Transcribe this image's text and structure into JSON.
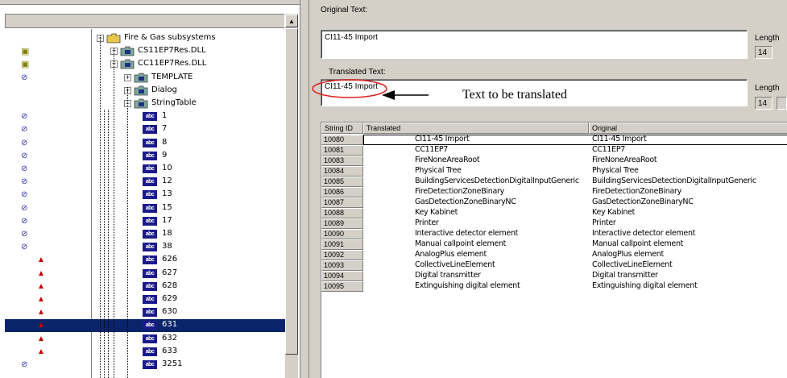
{
  "tree": {
    "scroll_up_glyph": "▲",
    "nodes": [
      {
        "label": "Fire & Gas subsystems",
        "icon": "folder-icon",
        "status": ""
      },
      {
        "label": "CS11EP7Res.DLL",
        "icon": "resource-dll-icon",
        "status": "dll"
      },
      {
        "label": "CC11EP7Res.DLL",
        "icon": "resource-dll-icon",
        "status": "dll"
      },
      {
        "label": "TEMPLATE",
        "icon": "resource-folder-icon",
        "status": "ok"
      },
      {
        "label": "Dialog",
        "icon": "resource-folder-icon",
        "status": ""
      },
      {
        "label": "StringTable",
        "icon": "resource-folder-icon",
        "status": ""
      },
      {
        "label": "1",
        "icon": "string-icon",
        "status": "ok"
      },
      {
        "label": "7",
        "icon": "string-icon",
        "status": "ok"
      },
      {
        "label": "8",
        "icon": "string-icon",
        "status": "ok"
      },
      {
        "label": "9",
        "icon": "string-icon",
        "status": "ok"
      },
      {
        "label": "10",
        "icon": "string-icon",
        "status": "ok"
      },
      {
        "label": "12",
        "icon": "string-icon",
        "status": "ok"
      },
      {
        "label": "13",
        "icon": "string-icon",
        "status": "ok"
      },
      {
        "label": "15",
        "icon": "string-icon",
        "status": "ok"
      },
      {
        "label": "17",
        "icon": "string-icon",
        "status": "ok"
      },
      {
        "label": "18",
        "icon": "string-icon",
        "status": "ok"
      },
      {
        "label": "38",
        "icon": "string-icon",
        "status": "ok"
      },
      {
        "label": "626",
        "icon": "string-icon",
        "status": "warn"
      },
      {
        "label": "627",
        "icon": "string-icon",
        "status": "warn"
      },
      {
        "label": "628",
        "icon": "string-icon",
        "status": "warn"
      },
      {
        "label": "629",
        "icon": "string-icon",
        "status": "warn"
      },
      {
        "label": "630",
        "icon": "string-icon",
        "status": "warn"
      },
      {
        "label": "631",
        "icon": "string-icon",
        "status": "warn",
        "selected": true
      },
      {
        "label": "632",
        "icon": "string-icon",
        "status": "warn"
      },
      {
        "label": "633",
        "icon": "string-icon",
        "status": "warn"
      },
      {
        "label": "3251",
        "icon": "string-icon",
        "status": "ok"
      }
    ],
    "string_icon_text": "abc",
    "expand_glyph": "+",
    "collapse_glyph": "−"
  },
  "editor": {
    "original_label": "Original Text:",
    "original_value": "CI11-45 Import",
    "original_length_label": "Length",
    "original_length": "14",
    "translated_label": "Translated Text:",
    "translated_value": "CI11-45 Import",
    "translated_length_label": "Length",
    "translated_length": "14"
  },
  "annotation": {
    "text": "Text to be translated"
  },
  "grid": {
    "columns": [
      "String ID",
      "Translated",
      "Original"
    ],
    "rows": [
      {
        "id": "10080",
        "translated": "CI11-45 Import",
        "original": "CI11-45 Import"
      },
      {
        "id": "10081",
        "translated": "CC11EP7",
        "original": "CC11EP7"
      },
      {
        "id": "10083",
        "translated": "FireNoneAreaRoot",
        "original": "FireNoneAreaRoot"
      },
      {
        "id": "10084",
        "translated": "Physical Tree",
        "original": "Physical Tree"
      },
      {
        "id": "10085",
        "translated": "BuildingServicesDetectionDigitalInputGeneric",
        "original": "BuildingServicesDetectionDigitalInputGeneric"
      },
      {
        "id": "10086",
        "translated": "FireDetectionZoneBinary",
        "original": "FireDetectionZoneBinary"
      },
      {
        "id": "10087",
        "translated": "GasDetectionZoneBinaryNC",
        "original": "GasDetectionZoneBinaryNC"
      },
      {
        "id": "10088",
        "translated": "Key Kabinet",
        "original": "Key Kabinet"
      },
      {
        "id": "10089",
        "translated": "Printer",
        "original": "Printer"
      },
      {
        "id": "10090",
        "translated": "Interactive detector element",
        "original": "Interactive detector element"
      },
      {
        "id": "10091",
        "translated": "Manual callpoint element",
        "original": "Manual callpoint element"
      },
      {
        "id": "10092",
        "translated": "AnalogPlus element",
        "original": "AnalogPlus element"
      },
      {
        "id": "10093",
        "translated": "CollectiveLineElement",
        "original": "CollectiveLineElement"
      },
      {
        "id": "10094",
        "translated": "Digital transmitter",
        "original": "Digital transmitter"
      },
      {
        "id": "10095",
        "translated": "Extinguishing digital element",
        "original": "Extinguishing digital element"
      }
    ]
  },
  "colors": {
    "selection": "#0a246a",
    "annotation_ellipse": "#e02020",
    "ok_icon": "#2a2aa8",
    "warn_icon": "#c00000"
  }
}
